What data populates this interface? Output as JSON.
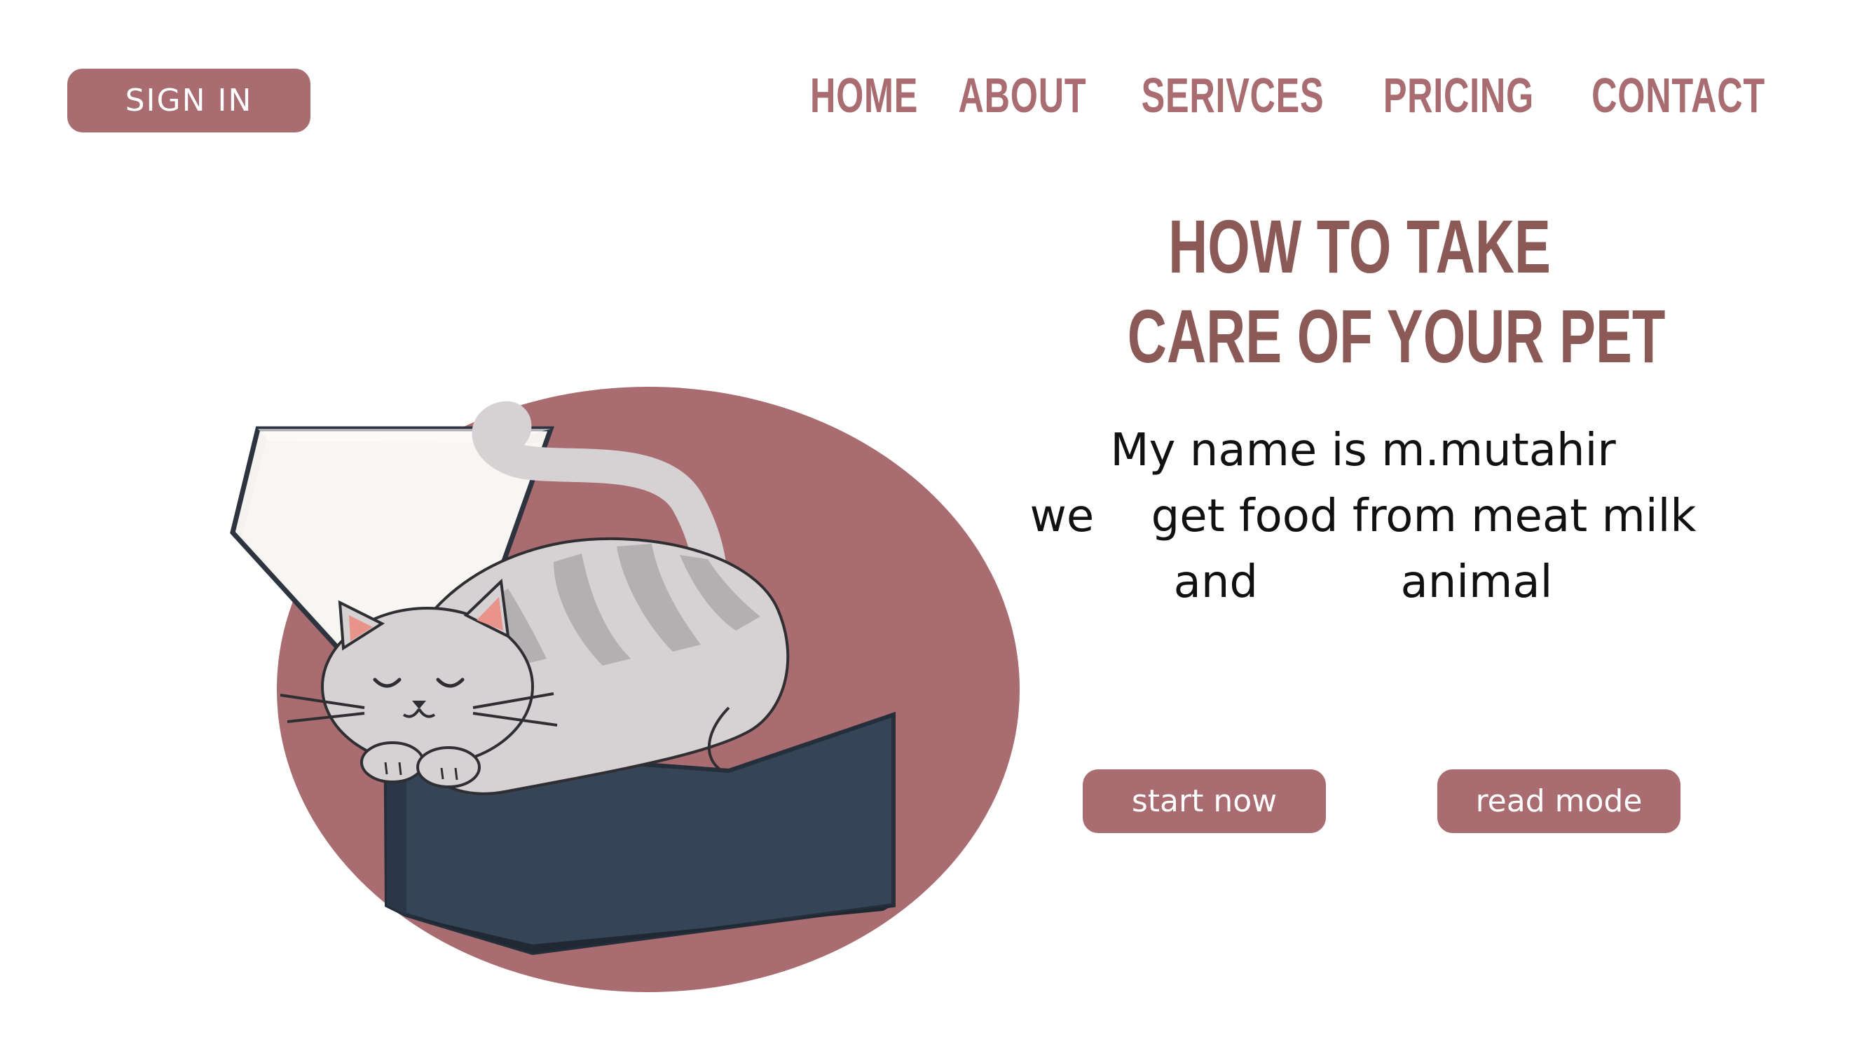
{
  "header": {
    "signin_label": "SIGN  IN",
    "nav": [
      "HOME",
      "ABOUT",
      "SERIVCES",
      "PRICING",
      "CONTACT"
    ]
  },
  "hero": {
    "title_line1": "HOW TO TAKE",
    "title_line2": "CARE OF YOUR PET",
    "body_line1": "My name is m.mutahir",
    "body_line2": "we    get food from meat milk",
    "body_line3": "and          animal",
    "start_label": "start now",
    "read_label": "read mode"
  },
  "illustration": {
    "name": "cat-in-box-icon"
  },
  "colors": {
    "accent": "#a86c71",
    "title": "#8b5a57",
    "box": "#354456",
    "cat": "#d6d2d4"
  }
}
